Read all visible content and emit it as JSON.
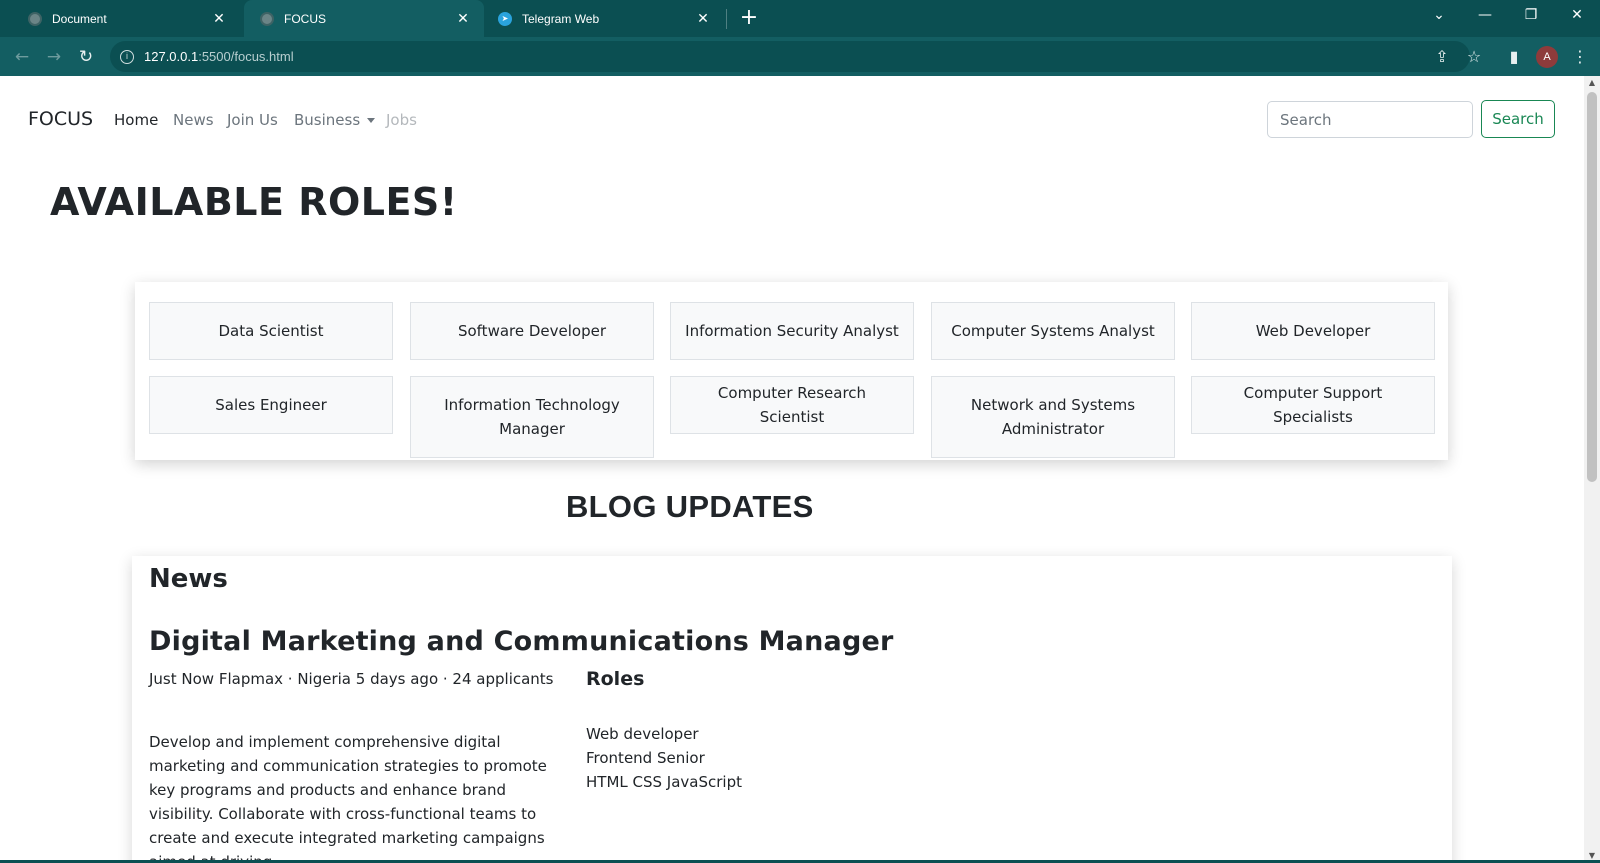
{
  "browser": {
    "tabs": [
      {
        "title": "Document",
        "icon": "globe-icon",
        "active": false
      },
      {
        "title": "FOCUS",
        "icon": "globe-icon",
        "active": true
      },
      {
        "title": "Telegram Web",
        "icon": "telegram-icon",
        "active": false
      }
    ],
    "address": {
      "host": "127.0.0.1",
      "path": ":5500/focus.html"
    },
    "avatar_letter": "A",
    "colors": {
      "chrome": "#0b4f52",
      "toolbar": "#135e62"
    }
  },
  "navbar": {
    "brand": "FOCUS",
    "links": [
      "Home",
      "News",
      "Join Us",
      "Business",
      "Jobs"
    ],
    "search": {
      "placeholder": "Search",
      "button": "Search"
    }
  },
  "hero": {
    "title": "AVAILABLE ROLES!"
  },
  "roles": [
    "Data Scientist",
    "Software Developer",
    "Information Security Analyst",
    "Computer Systems Analyst",
    "Web Developer",
    "Sales Engineer",
    "Information Technology Manager",
    "Computer Research Scientist",
    "Network and Systems Administrator",
    "Computer Support Specialists"
  ],
  "blog": {
    "title": "BLOG UPDATES",
    "section": "News",
    "job": {
      "title": "Digital Marketing and Communications Manager",
      "meta": "Just Now Flapmax · Nigeria 5 days ago · 24 applicants",
      "description": "Develop and implement comprehensive digital marketing and communication strategies to promote key programs and products and enhance brand visibility. Collaborate with cross-functional teams to create and execute integrated marketing campaigns aimed at driving",
      "roles_heading": "Roles",
      "roles": [
        "Web developer",
        "Frontend Senior",
        "HTML CSS JavaScript"
      ]
    }
  },
  "theme": {
    "accent": "#198754"
  }
}
